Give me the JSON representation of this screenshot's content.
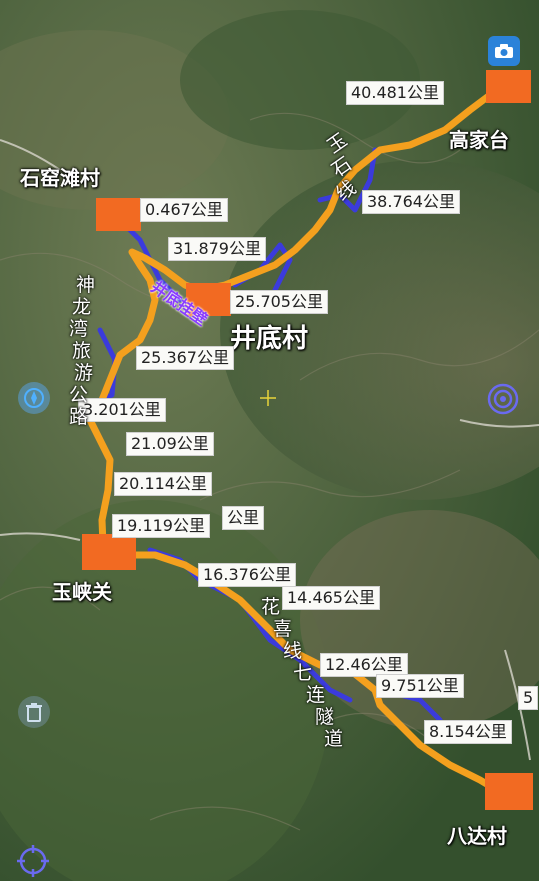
{
  "colors": {
    "route": "#f4a01e",
    "road": "#3b3bdc",
    "marker": "#f26a22",
    "label_bg": "#fafaf7"
  },
  "places": {
    "gaojiatai": "高家台",
    "shiyaotan": "石窑滩村",
    "jingdi": "井底村",
    "yuxiaguan": "玉峡关",
    "bada": "八达村"
  },
  "road_labels": {
    "yushi": [
      "玉",
      "石",
      "线"
    ],
    "shenlongwan": [
      "神",
      "龙",
      "湾",
      "旅",
      "游",
      "公",
      "路"
    ],
    "huaxi": [
      "花",
      "喜",
      "线",
      "七",
      "连",
      "隧",
      "道"
    ],
    "jingdi_wall": "井底挂壁"
  },
  "distances": [
    "40.481公里",
    "38.764公里",
    "0.467公里",
    "31.879公里",
    "25.705公里",
    "25.367公里",
    "3.201公里",
    "21.09公里",
    "20.114公里",
    "19.119公里",
    "公里",
    "16.376公里",
    "14.465公里",
    "12.46公里",
    "9.751公里",
    "8.154公里",
    "5"
  ],
  "controls": [
    "camera-icon",
    "compass-icon",
    "target-icon",
    "trash-icon",
    "locate-icon"
  ]
}
